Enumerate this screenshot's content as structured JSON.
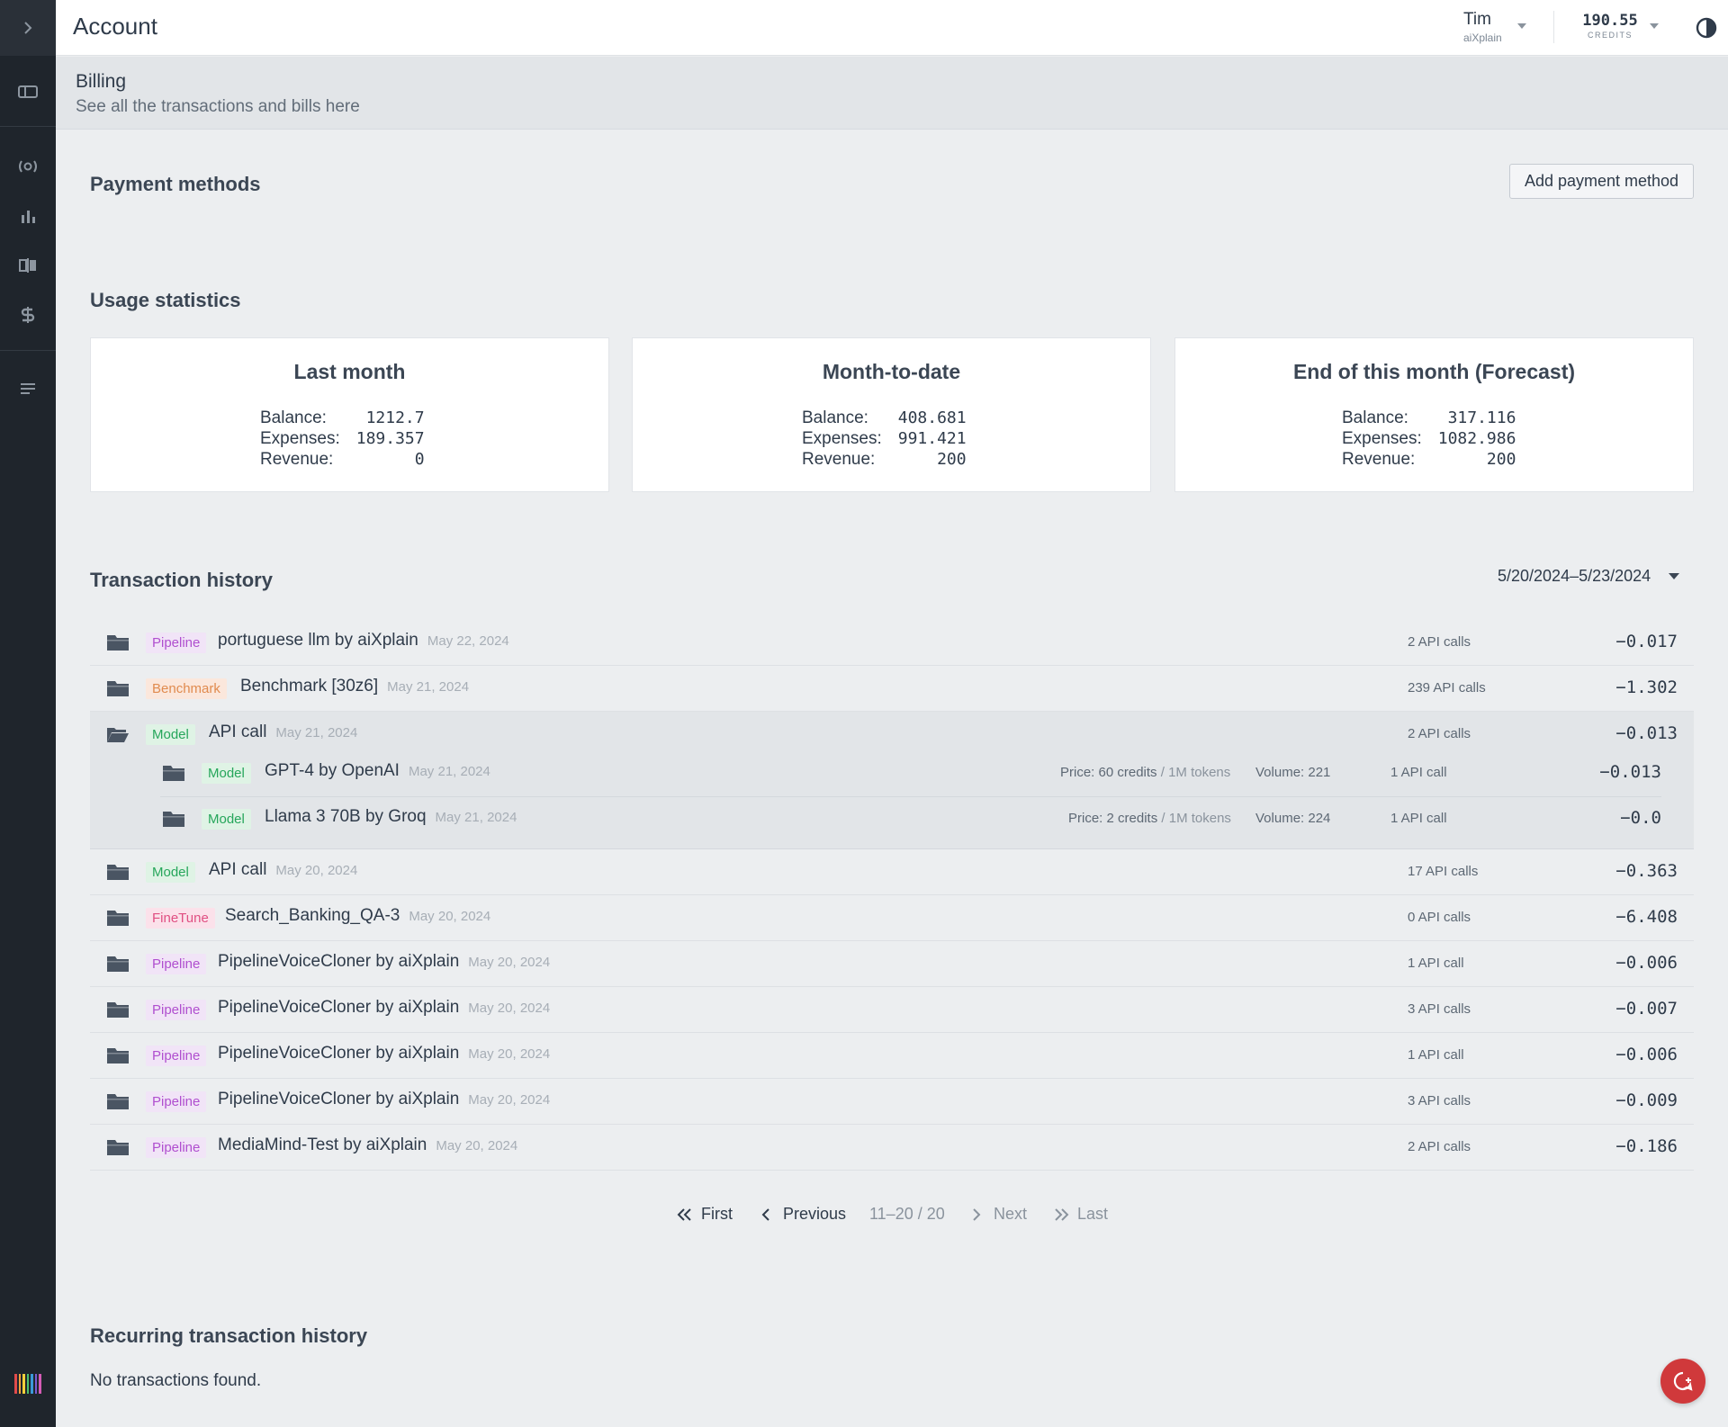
{
  "topbar": {
    "title": "Account",
    "user_name": "Tim",
    "user_org": "aiXplain",
    "credits_value": "190.55",
    "credits_label": "CREDITS"
  },
  "sidebar": {
    "icons": [
      "chevron-right-icon",
      "dashboard-icon",
      "broadcast-icon",
      "bar-chart-icon",
      "compare-icon",
      "billing-icon",
      "list-icon"
    ],
    "logo_colors": [
      "#e14b4b",
      "#f0a13c",
      "#f2d03b",
      "#4cc06c",
      "#3a9ad9",
      "#7a5cd1",
      "#d45bb5"
    ]
  },
  "header": {
    "title": "Billing",
    "subtitle": "See all the transactions and bills here"
  },
  "payment_methods": {
    "title": "Payment methods",
    "add_button": "Add payment method"
  },
  "usage": {
    "title": "Usage statistics",
    "cards": [
      {
        "title": "Last month",
        "balance_label": "Balance:",
        "balance": "1212.7",
        "expenses_label": "Expenses:",
        "expenses": "189.357",
        "revenue_label": "Revenue:",
        "revenue": "0"
      },
      {
        "title": "Month-to-date",
        "balance_label": "Balance:",
        "balance": "408.681",
        "expenses_label": "Expenses:",
        "expenses": "991.421",
        "revenue_label": "Revenue:",
        "revenue": "200"
      },
      {
        "title": "End of this month (Forecast)",
        "balance_label": "Balance:",
        "balance": "317.116",
        "expenses_label": "Expenses:",
        "expenses": "1082.986",
        "revenue_label": "Revenue:",
        "revenue": "200"
      }
    ]
  },
  "transactions": {
    "title": "Transaction history",
    "date_range": "5/20/2024–5/23/2024",
    "rows": [
      {
        "tag": "Pipeline",
        "name": "portuguese llm by aiXplain",
        "date": "May 22, 2024",
        "calls": "2 API calls",
        "amount": "−0.017"
      },
      {
        "tag": "Benchmark",
        "name": "Benchmark [30z6]",
        "date": "May 21, 2024",
        "calls": "239 API calls",
        "amount": "−1.302"
      },
      {
        "tag": "Model",
        "name": "API call",
        "date": "May 21, 2024",
        "calls": "2 API calls",
        "amount": "−0.013",
        "children": [
          {
            "tag": "Model",
            "name": "GPT-4 by OpenAI",
            "date": "May 21, 2024",
            "price_label": "Price:",
            "price": "60 credits",
            "price_unit": " / 1M tokens",
            "volume_label": "Volume:",
            "volume": "221",
            "calls": "1 API call",
            "amount": "−0.013"
          },
          {
            "tag": "Model",
            "name": "Llama 3 70B by Groq",
            "date": "May 21, 2024",
            "price_label": "Price:",
            "price": "2 credits",
            "price_unit": " / 1M tokens",
            "volume_label": "Volume:",
            "volume": "224",
            "calls": "1 API call",
            "amount": "−0.0"
          }
        ]
      },
      {
        "tag": "Model",
        "name": "API call",
        "date": "May 20, 2024",
        "calls": "17 API calls",
        "amount": "−0.363"
      },
      {
        "tag": "FineTune",
        "name": "Search_Banking_QA-3",
        "date": "May 20, 2024",
        "calls": "0 API calls",
        "amount": "−6.408"
      },
      {
        "tag": "Pipeline",
        "name": "PipelineVoiceCloner by aiXplain",
        "date": "May 20, 2024",
        "calls": "1 API call",
        "amount": "−0.006"
      },
      {
        "tag": "Pipeline",
        "name": "PipelineVoiceCloner by aiXplain",
        "date": "May 20, 2024",
        "calls": "3 API calls",
        "amount": "−0.007"
      },
      {
        "tag": "Pipeline",
        "name": "PipelineVoiceCloner by aiXplain",
        "date": "May 20, 2024",
        "calls": "1 API call",
        "amount": "−0.006"
      },
      {
        "tag": "Pipeline",
        "name": "PipelineVoiceCloner by aiXplain",
        "date": "May 20, 2024",
        "calls": "3 API calls",
        "amount": "−0.009"
      },
      {
        "tag": "Pipeline",
        "name": "MediaMind-Test by aiXplain",
        "date": "May 20, 2024",
        "calls": "2 API calls",
        "amount": "−0.186"
      }
    ]
  },
  "pagination": {
    "first": "First",
    "previous": "Previous",
    "range": "11–20 / 20",
    "next": "Next",
    "last": "Last"
  },
  "recurring": {
    "title": "Recurring transaction history",
    "empty": "No transactions found."
  }
}
